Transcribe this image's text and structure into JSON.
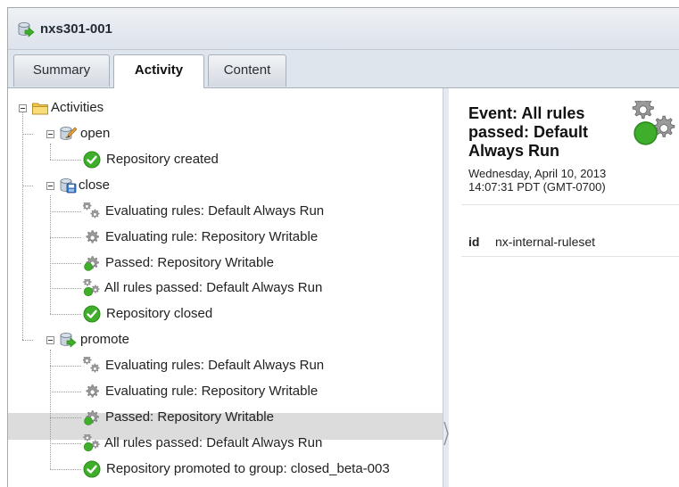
{
  "window": {
    "title": "nxs301-001",
    "icon": "repository-promote-icon"
  },
  "tabs": [
    {
      "label": "Summary",
      "active": false
    },
    {
      "label": "Activity",
      "active": true
    },
    {
      "label": "Content",
      "active": false
    }
  ],
  "tree": {
    "root": {
      "label": "Activities",
      "icon": "folder-open-icon",
      "expanded": true
    },
    "groups": [
      {
        "label": "open",
        "icon": "repository-open-icon",
        "expanded": true,
        "children": [
          {
            "label": "Repository created",
            "icon": "check-circle-icon"
          }
        ]
      },
      {
        "label": "close",
        "icon": "repository-close-icon",
        "expanded": true,
        "children": [
          {
            "label": "Evaluating rules: Default Always Run",
            "icon": "gears-icon"
          },
          {
            "label": "Evaluating rule: Repository Writable",
            "icon": "gear-icon"
          },
          {
            "label": "Passed: Repository Writable",
            "icon": "gear-check-icon"
          },
          {
            "label": "All rules passed: Default Always Run",
            "icon": "gears-check-icon"
          },
          {
            "label": "Repository closed",
            "icon": "check-circle-icon"
          }
        ]
      },
      {
        "label": "promote",
        "icon": "repository-promote-icon",
        "expanded": true,
        "children": [
          {
            "label": "Evaluating rules: Default Always Run",
            "icon": "gears-icon"
          },
          {
            "label": "Evaluating rule: Repository Writable",
            "icon": "gear-icon"
          },
          {
            "label": "Passed: Repository Writable",
            "icon": "gear-check-icon"
          },
          {
            "label": "All rules passed: Default Always Run",
            "icon": "gears-check-icon",
            "selected": true
          },
          {
            "label": "Repository promoted to group: closed_beta-003",
            "icon": "check-circle-icon"
          }
        ]
      }
    ]
  },
  "detail": {
    "event_title": "Event: All rules passed: Default Always Run",
    "event_date_line1": "Wednesday, April 10, 2013",
    "event_date_line2": "14:07:31 PDT (GMT-0700)",
    "event_icon": "gears-check-icon",
    "properties": [
      {
        "key": "id",
        "value": "nx-internal-ruleset"
      }
    ]
  },
  "colors": {
    "check_green": "#3fae2a",
    "gear_gray": "#8c8c8c",
    "folder_yellow": "#f2c94c",
    "selection_gray": "#dcdcdc",
    "titlebar_bg": "#e6ebf1"
  }
}
